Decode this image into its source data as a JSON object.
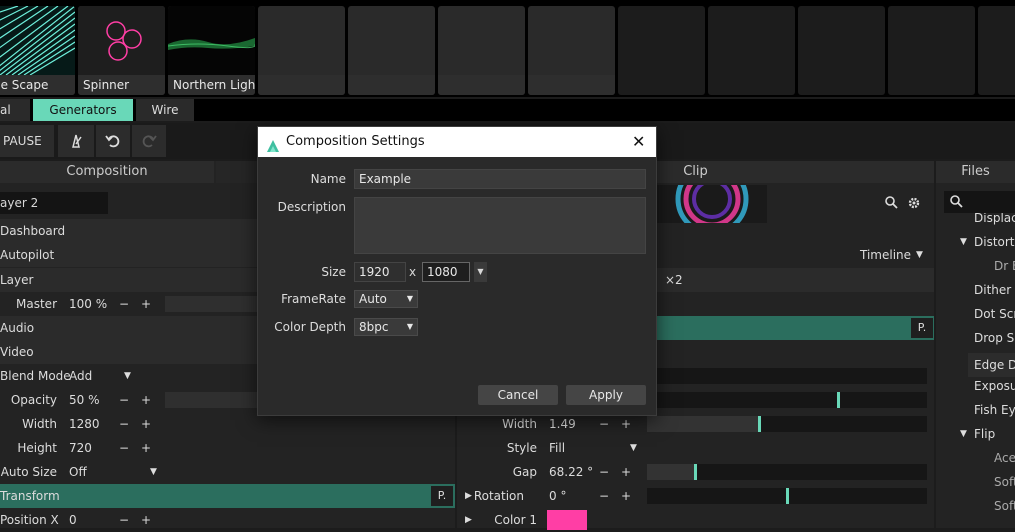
{
  "thumbnails": [
    {
      "label": "ne Scape"
    },
    {
      "label": "Spinner"
    },
    {
      "label": "Northern Light"
    },
    {
      "label": ""
    },
    {
      "label": ""
    },
    {
      "label": ""
    },
    {
      "label": ""
    }
  ],
  "tabs": [
    {
      "label": "al",
      "active": false
    },
    {
      "label": "Generators",
      "active": true
    },
    {
      "label": "Wire",
      "active": false
    }
  ],
  "toolbar": {
    "pause_label": "PAUSE"
  },
  "left_panel": {
    "header": "Composition",
    "layer_name": "ayer 2",
    "sections": {
      "dashboard": "Dashboard",
      "autopilot": "Autopilot",
      "layer": "Layer",
      "audio": "Audio",
      "video": "Video",
      "transform": "Transform"
    },
    "master": {
      "label": "Master",
      "value": "100 %"
    },
    "blend_mode": {
      "label": "Blend Mode",
      "value": "Add"
    },
    "opacity": {
      "label": "Opacity",
      "value": "50 %",
      "level": 0.5
    },
    "width": {
      "label": "Width",
      "value": "1280"
    },
    "height": {
      "label": "Height",
      "value": "720"
    },
    "auto_size": {
      "label": "Auto Size",
      "value": "Off"
    },
    "position_x": {
      "label": "Position X",
      "value": "0"
    },
    "minus": "−",
    "plus": "+"
  },
  "clip_panel": {
    "header": "Clip",
    "timeline": "Timeline",
    "speed": "×2",
    "p_button": "P.",
    "width": {
      "label": "Width",
      "value": "1.49",
      "level": 0.4
    },
    "style": {
      "label": "Style",
      "value": "Fill"
    },
    "gap": {
      "label": "Gap",
      "value": "68.22 °",
      "level": 0.17
    },
    "rotation": {
      "label": "Rotation",
      "value": "0 °",
      "level": 0.5
    },
    "color1": {
      "label": "Color 1",
      "color": "#ff3ea5"
    },
    "minus": "−",
    "plus": "+"
  },
  "files_panel": {
    "header": "Files",
    "items": [
      "Displace",
      "Distortio",
      "Dr E",
      "Dither",
      "Dot Scre",
      "Drop Sh",
      "Edge De",
      "Exposu",
      "Fish Eye",
      "Flip",
      "Ace",
      "Soft",
      "Soft"
    ]
  },
  "dialog": {
    "title": "Composition Settings",
    "name_label": "Name",
    "name_value": "Example",
    "description_label": "Description",
    "description_value": "",
    "size_label": "Size",
    "size_w": "1920",
    "size_x": "x",
    "size_h": "1080",
    "framerate_label": "FrameRate",
    "framerate_value": "Auto",
    "colordepth_label": "Color Depth",
    "colordepth_value": "8bpc",
    "cancel_label": "Cancel",
    "apply_label": "Apply"
  },
  "colors": {
    "accent": "#69d8b8",
    "transform_row": "#2b6e5e",
    "brand": "#3fbfa0"
  }
}
